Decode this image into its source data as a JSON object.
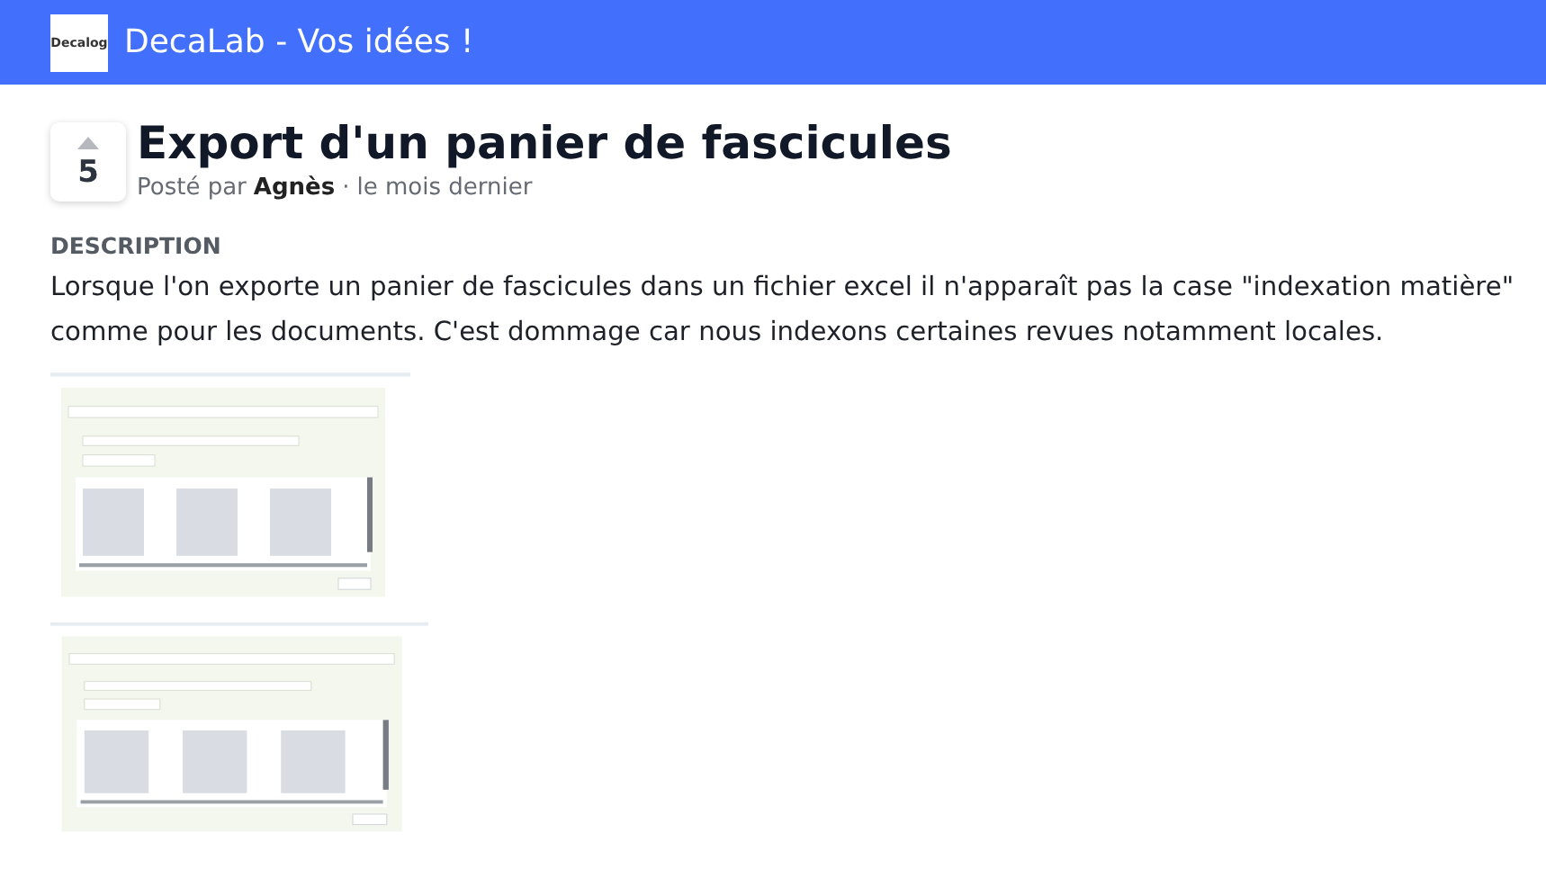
{
  "header": {
    "logo": "Decalog",
    "title": "DecaLab - Vos idées !"
  },
  "post": {
    "votes": "5",
    "title": "Export d'un panier de fascicules",
    "meta": {
      "prefix": "Posté par",
      "author": "Agnès",
      "separator": "·",
      "time": "le mois dernier"
    },
    "description_heading": "DESCRIPTION",
    "description": "Lorsque l'on exporte un panier de fascicules dans un fichier excel il n'apparaît pas la case \"indexation matière\" comme pour les documents. C'est dommage car nous indexons certaines revues notamment locales."
  }
}
